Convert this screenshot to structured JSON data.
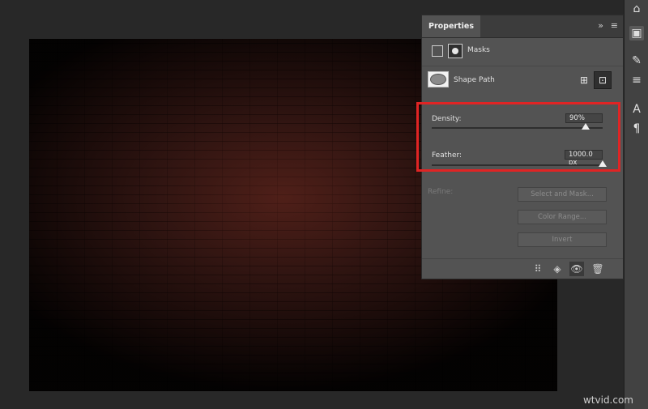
{
  "properties_panel": {
    "tab_label": "Properties",
    "collapse_glyph": "»",
    "menu_glyph": "≡",
    "section_label": "Masks",
    "shape_path_label": "Shape Path",
    "apply_mask_glyph": "⊞",
    "select_mask_glyph": "⊡",
    "density": {
      "label": "Density:",
      "value": "90%",
      "level_percent": 90
    },
    "feather": {
      "label": "Feather:",
      "value": "1000.0 px",
      "level_percent": 100
    },
    "refine_label": "Refine:",
    "buttons": {
      "select_and_mask": "Select and Mask...",
      "color_range": "Color Range...",
      "invert": "Invert"
    },
    "footer_glyphs": {
      "load_selection": "⠿",
      "apply_mask": "◈",
      "toggle_visibility": "👁",
      "delete": "🗑"
    }
  },
  "right_toolbar_glyphs": [
    "⌂",
    "▣",
    "✎",
    "≡",
    "A",
    "¶"
  ],
  "watermark": "wtvid.com",
  "colors": {
    "highlight": "#e02424",
    "panel_bg": "#535353",
    "app_bg": "#282828"
  }
}
